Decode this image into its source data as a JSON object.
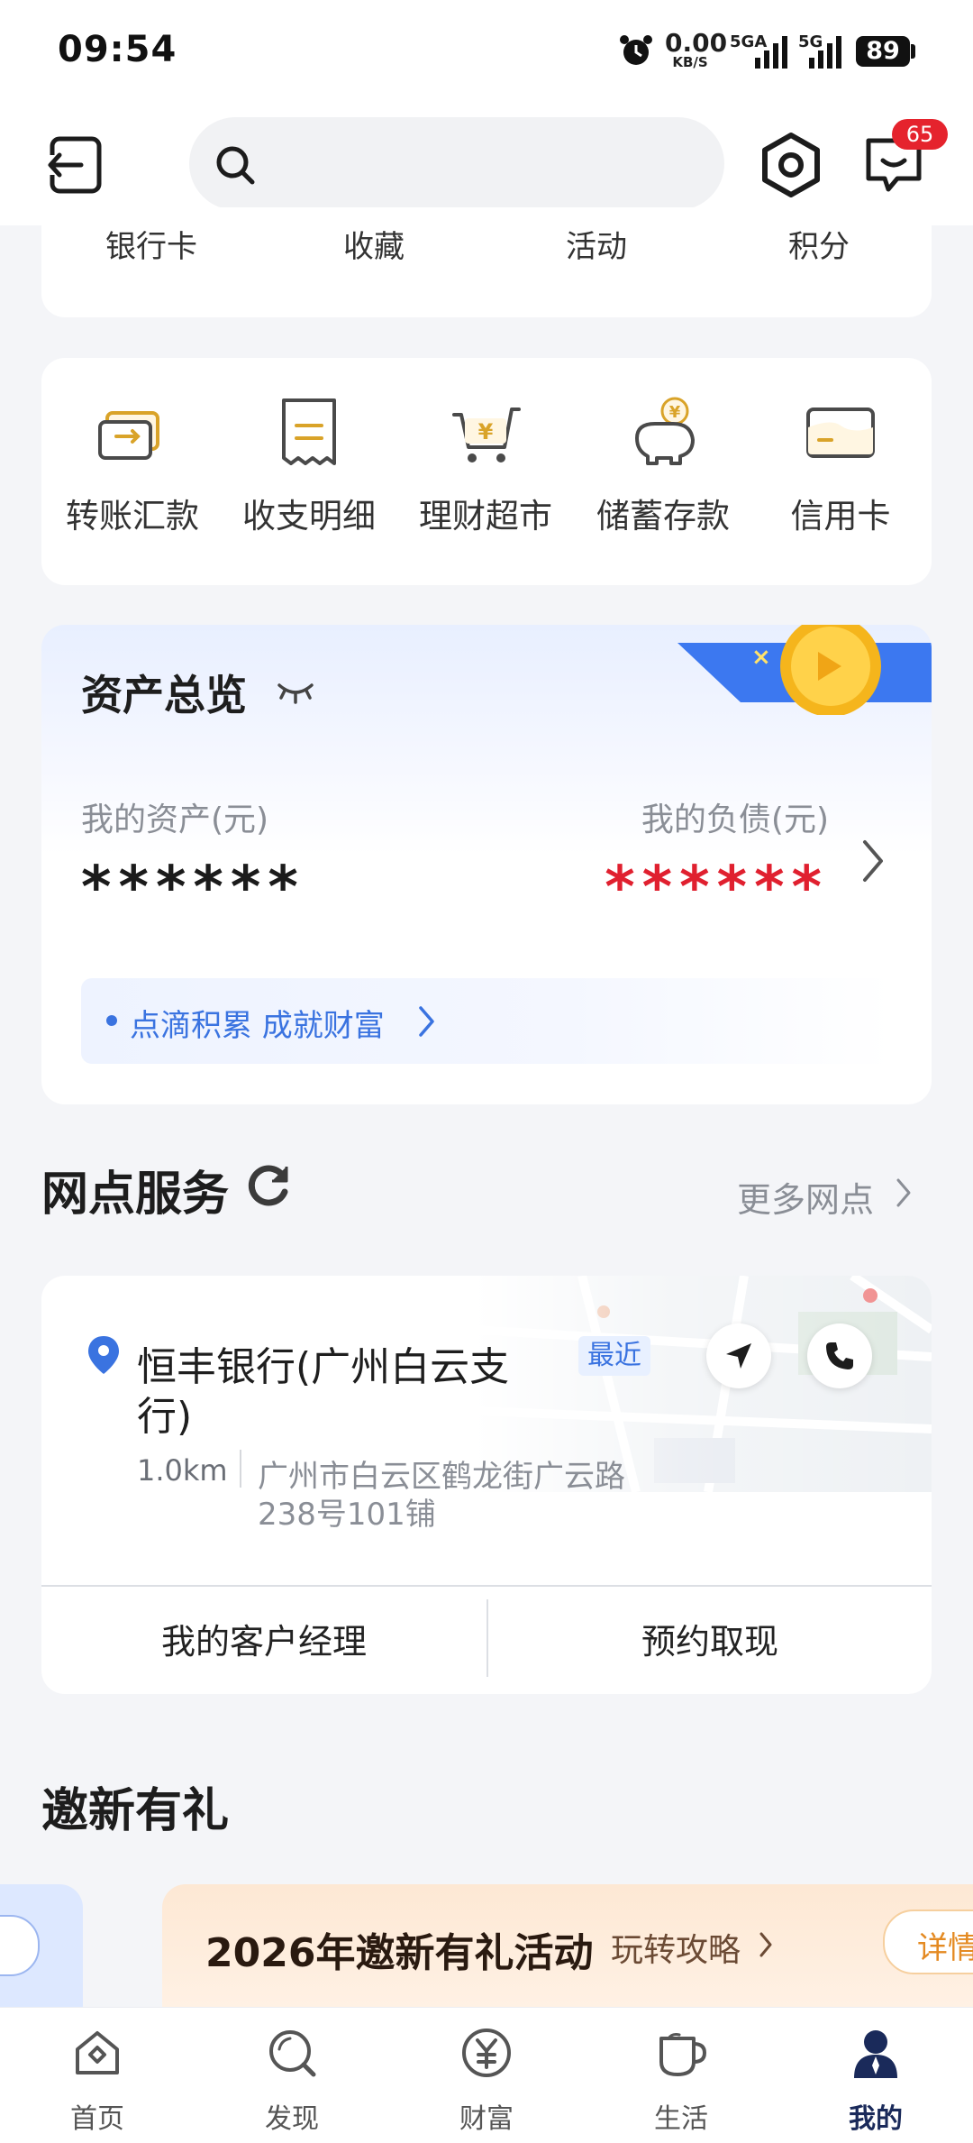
{
  "status_bar": {
    "time": "09:54",
    "speed_value": "0.00",
    "speed_unit": "KB/S",
    "net1": "5G",
    "net1_sub": "A",
    "net2": "5G",
    "battery": "89"
  },
  "header": {
    "search_placeholder": "",
    "message_badge": "65",
    "icons": [
      "logout-icon",
      "search-icon",
      "settings-icon",
      "message-icon"
    ]
  },
  "quick_tabs": [
    "银行卡",
    "收藏",
    "活动",
    "积分"
  ],
  "services": [
    {
      "label": "转账汇款",
      "icon": "transfer-icon"
    },
    {
      "label": "收支明细",
      "icon": "receipt-icon"
    },
    {
      "label": "理财超市",
      "icon": "cart-icon"
    },
    {
      "label": "储蓄存款",
      "icon": "piggy-bank-icon"
    },
    {
      "label": "信用卡",
      "icon": "credit-card-icon"
    }
  ],
  "assets": {
    "title": "资产总览",
    "my_assets_label": "我的资产(元)",
    "my_assets_value": "******",
    "my_liabilities_label": "我的负债(元)",
    "my_liabilities_value": "******",
    "slogan": "点滴积累 成就财富"
  },
  "branch": {
    "section_title": "网点服务",
    "more_link": "更多网点",
    "name_line1": "恒丰银行(广州白云支",
    "name_line2": "行)",
    "tag": "最近",
    "distance": "1.0km",
    "address_line1": "广州市白云区鹤龙街广云路",
    "address_line2": "238号101铺",
    "btn_manager": "我的客户经理",
    "btn_withdraw": "预约取现"
  },
  "invite": {
    "title": "邀新有礼",
    "banner_title": "2026年邀新有礼活动",
    "banner_link": "玩转攻略",
    "banner_button": "详情"
  },
  "tab_bar": [
    {
      "label": "首页",
      "icon": "home-icon"
    },
    {
      "label": "发现",
      "icon": "discover-icon"
    },
    {
      "label": "财富",
      "icon": "wealth-icon"
    },
    {
      "label": "生活",
      "icon": "life-cup-icon"
    },
    {
      "label": "我的",
      "icon": "profile-icon",
      "active": true
    }
  ],
  "colors": {
    "accent_blue": "#3a73e0",
    "liability_red": "#e0202f",
    "badge_red": "#e5232d",
    "gold": "#d9a329",
    "page_bg": "#f4f5f8"
  }
}
